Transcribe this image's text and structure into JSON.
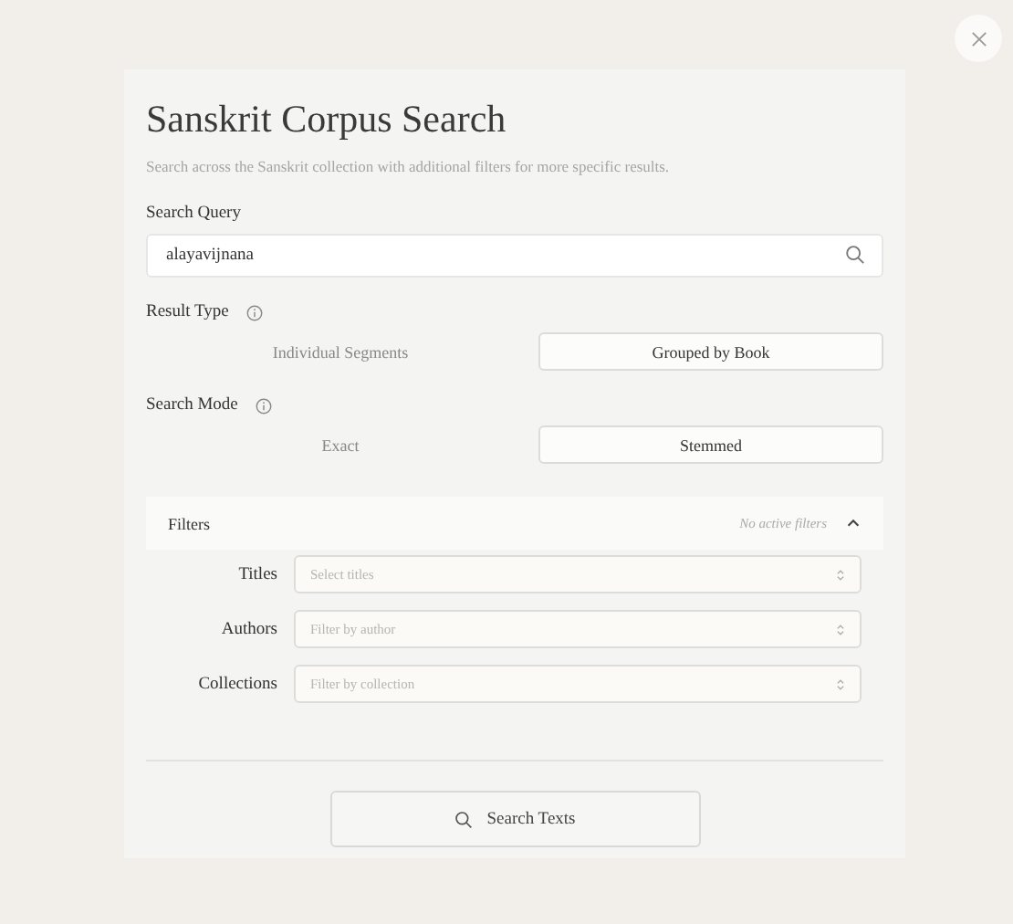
{
  "title": "Sanskrit Corpus Search",
  "description": "Search across the Sanskrit collection with additional filters for more specific results.",
  "query": {
    "label": "Search Query",
    "value": "alayavijnana"
  },
  "option_groups": [
    {
      "label": "Result Type",
      "options": [
        {
          "label": "Individual Segments",
          "selected": false
        },
        {
          "label": "Grouped by Book",
          "selected": true
        }
      ]
    },
    {
      "label": "Search Mode",
      "options": [
        {
          "label": "Exact",
          "selected": false
        },
        {
          "label": "Stemmed",
          "selected": true
        }
      ]
    }
  ],
  "filters": {
    "title": "Filters",
    "status": "No active filters",
    "expanded": true,
    "fields": [
      {
        "label": "Titles",
        "placeholder": "Select titles"
      },
      {
        "label": "Authors",
        "placeholder": "Filter by author"
      },
      {
        "label": "Collections",
        "placeholder": "Filter by collection"
      }
    ]
  },
  "submit": "Search Texts"
}
